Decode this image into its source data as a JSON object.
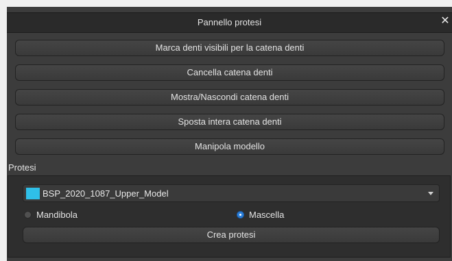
{
  "window": {
    "title": "Pannello protesi",
    "close_glyph": "✕"
  },
  "actions": [
    {
      "label": "Marca denti visibili per la catena denti"
    },
    {
      "label": "Cancella catena denti"
    },
    {
      "label": "Mostra/Nascondi catena denti"
    },
    {
      "label": "Sposta intera catena denti"
    },
    {
      "label": "Manipola modello"
    }
  ],
  "protesi": {
    "group_label": "Protesi",
    "selected_model": "BSP_2020_1087_Upper_Model",
    "model_color": "#2fbfe8",
    "jaw_options": [
      {
        "label": "Mandibola",
        "checked": false
      },
      {
        "label": "Mascella",
        "checked": true
      }
    ],
    "create_label": "Crea protesi"
  },
  "icons": {
    "close": "close-icon",
    "dropdown": "chevron-down-icon"
  }
}
